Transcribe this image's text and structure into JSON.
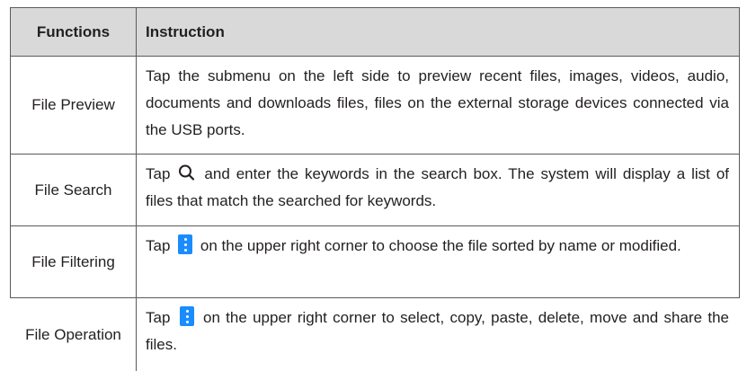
{
  "table": {
    "headers": [
      "Functions",
      "Instruction"
    ],
    "rows": [
      {
        "function": "File Preview",
        "instruction": "Tap the submenu on the left side to preview recent files, images, videos, audio, documents and downloads files, files on the external storage devices connected via the USB ports."
      },
      {
        "function": "File Search",
        "instruction_before": "Tap",
        "icon": "search-icon",
        "instruction_after": "and enter the keywords in the search box. The system will display a list of files that match the searched for keywords."
      },
      {
        "function": "File Filtering",
        "instruction_before": "Tap",
        "icon": "more-vertical-icon",
        "instruction_after": "on the upper right corner to choose the file sorted by name or modified."
      },
      {
        "function": "File Operation",
        "instruction_before": "Tap",
        "icon": "more-vertical-icon",
        "instruction_after": "on the upper right corner to select, copy, paste, delete, move and share the files."
      }
    ]
  },
  "colors": {
    "header_bg": "#d9d9d9",
    "border": "#5a5a5a",
    "icon_blue": "#1a8cff",
    "text": "#231f20"
  }
}
